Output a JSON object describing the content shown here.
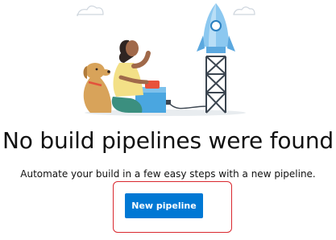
{
  "empty_state": {
    "title": "No build pipelines were found",
    "subtitle": "Automate your build in a few easy steps with a new pipeline.",
    "primary_action_label": "New pipeline"
  },
  "colors": {
    "primary_button": "#0078d4",
    "highlight_border": "#d9282f"
  },
  "illustration": {
    "icons": [
      "cloud-icon",
      "rocket-icon",
      "person-icon",
      "dog-icon",
      "launch-box-icon",
      "launch-tower-icon"
    ]
  }
}
